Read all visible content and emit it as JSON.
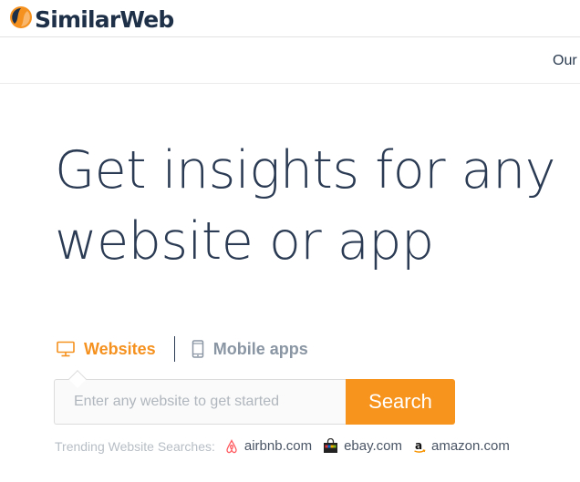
{
  "header": {
    "logo_text": "SimilarWeb",
    "logo_icon": "similarweb-logo-icon",
    "brand_color": "#f5911e"
  },
  "nav": {
    "partial_item": "Our"
  },
  "hero": {
    "line1": "Get insights for any",
    "line2": "website or app"
  },
  "tabs": [
    {
      "label": "Websites",
      "icon": "monitor-icon",
      "active": true,
      "color": "#f5911e"
    },
    {
      "label": "Mobile apps",
      "icon": "mobile-phone-icon",
      "active": false,
      "color": "#8a96a3"
    }
  ],
  "search": {
    "placeholder": "Enter any website to get started",
    "value": "",
    "button_label": "Search",
    "button_color": "#f7941d"
  },
  "trending": {
    "label": "Trending Website Searches:",
    "items": [
      {
        "text": "airbnb.com",
        "icon": "airbnb-icon"
      },
      {
        "text": "ebay.com",
        "icon": "ebay-icon"
      },
      {
        "text": "amazon.com",
        "icon": "amazon-icon"
      }
    ]
  }
}
